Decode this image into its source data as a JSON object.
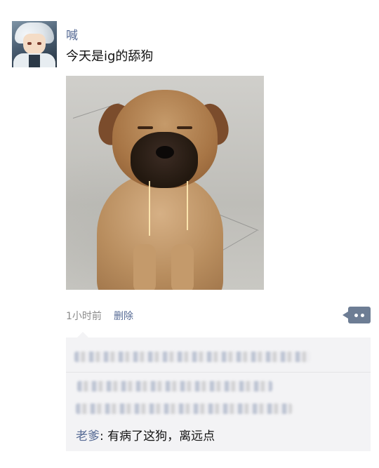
{
  "post": {
    "author": "喊",
    "text": "今天是ig的舔狗",
    "time": "1小时前",
    "delete_label": "删除"
  },
  "comments": {
    "visible_reply": {
      "name": "老爹",
      "separator": ":",
      "text": " 有病了这狗，离远点"
    }
  },
  "colors": {
    "link": "#576b95",
    "comment_bg": "#f3f3f5",
    "more_button": "#6d7d94"
  },
  "icons": {
    "more": "more-dots-icon"
  }
}
